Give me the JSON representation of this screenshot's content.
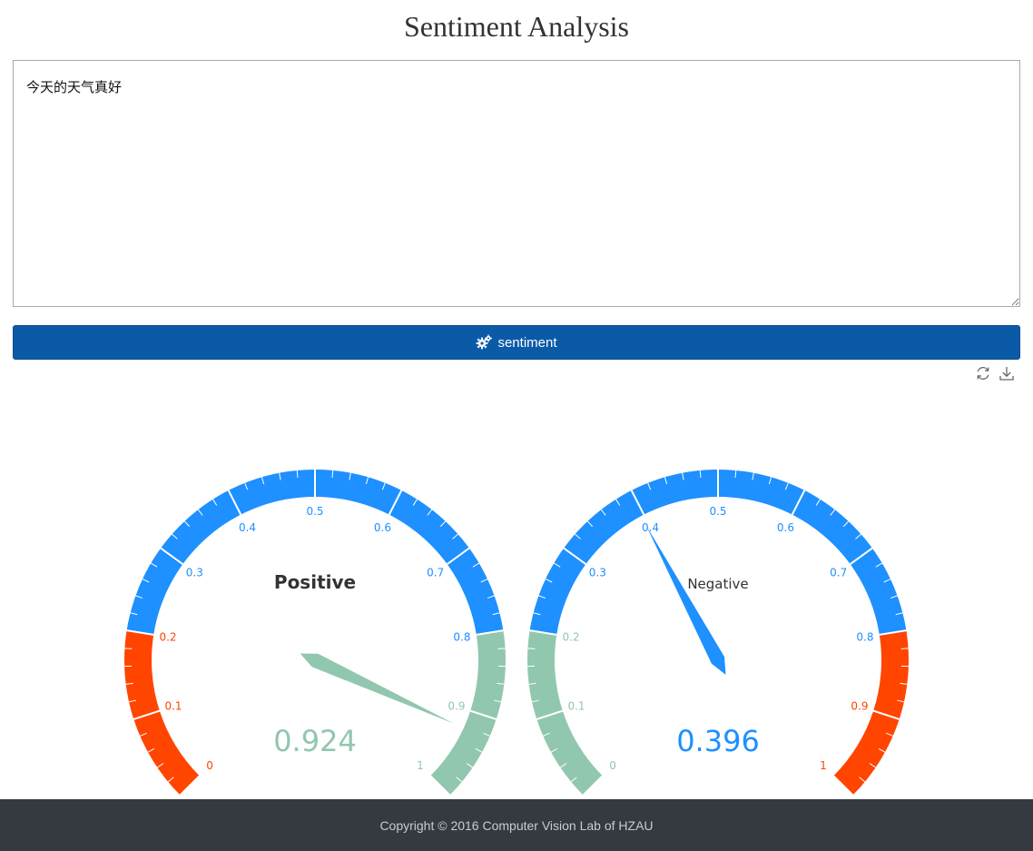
{
  "header": {
    "title": "Sentiment Analysis"
  },
  "input": {
    "value": "今天的天气真好"
  },
  "action": {
    "label": "sentiment",
    "icon": "gears-icon"
  },
  "toolbox": {
    "icons": [
      "refresh-icon",
      "download-icon"
    ]
  },
  "chart_data": [
    {
      "type": "gauge",
      "title": "Positive",
      "value": 0.924,
      "value_label": "0.924",
      "min": 0,
      "max": 1,
      "tick_labels": [
        "0",
        "0.1",
        "0.2",
        "0.3",
        "0.4",
        "0.5",
        "0.6",
        "0.7",
        "0.8",
        "0.9",
        "1"
      ],
      "color_bands": [
        {
          "to": 0.2,
          "color": "#ff4500"
        },
        {
          "to": 0.8,
          "color": "#1e90ff"
        },
        {
          "to": 1.0,
          "color": "#91c7ae"
        }
      ],
      "pointer_color": "#91c7ae",
      "title_bold": true
    },
    {
      "type": "gauge",
      "title": "Negative",
      "value": 0.396,
      "value_label": "0.396",
      "min": 0,
      "max": 1,
      "tick_labels": [
        "0",
        "0.1",
        "0.2",
        "0.3",
        "0.4",
        "0.5",
        "0.6",
        "0.7",
        "0.8",
        "0.9",
        "1"
      ],
      "color_bands": [
        {
          "to": 0.2,
          "color": "#91c7ae"
        },
        {
          "to": 0.8,
          "color": "#1e90ff"
        },
        {
          "to": 1.0,
          "color": "#ff4500"
        }
      ],
      "pointer_color": "#1e90ff",
      "title_bold": false
    }
  ],
  "footer": {
    "text": "Copyright © 2016 Computer Vision Lab of HZAU"
  }
}
